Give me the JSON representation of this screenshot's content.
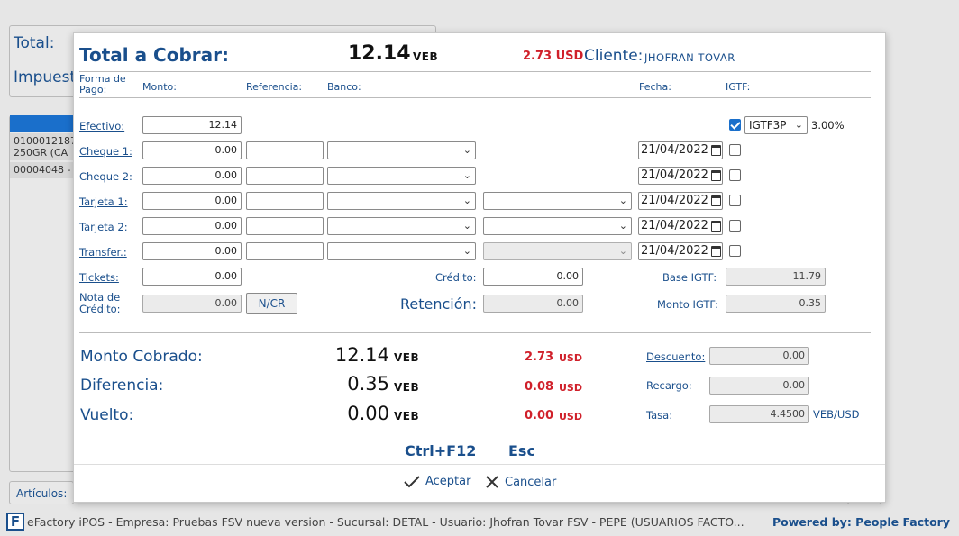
{
  "background": {
    "total_label": "Total:",
    "impuesto_label": "Impuest",
    "list_items": [
      "0100012187",
      "250GR (CA",
      "00004048 -"
    ],
    "articulos_label": "Artículos:"
  },
  "footer": {
    "info": "eFactory iPOS - Empresa: Pruebas FSV nueva version - Sucursal: DETAL - Usuario: Jhofran Tovar FSV - PEPE (USUARIOS FACTO...",
    "powered": "Powered by: People Factory",
    "logo_letter": "F"
  },
  "header": {
    "title": "Total a Cobrar:",
    "total_value": "12.14",
    "total_currency": "VEB",
    "usd_value": "2.73 USD",
    "cliente_label": "Cliente:",
    "cliente_value": "JHOFRAN TOVAR"
  },
  "columns": {
    "forma_de_pago": "Forma de Pago:",
    "monto": "Monto:",
    "referencia": "Referencia:",
    "banco": "Banco:",
    "fecha": "Fecha:",
    "igtf": "IGTF:"
  },
  "payment_rows": [
    {
      "label": "Efectivo:",
      "monto": "12.14"
    },
    {
      "label": "Cheque 1:",
      "monto": "0.00",
      "fecha": "21/04/2022"
    },
    {
      "label": "Cheque 2:",
      "monto": "0.00",
      "fecha": "21/04/2022"
    },
    {
      "label": "Tarjeta 1:",
      "monto": "0.00",
      "fecha": "21/04/2022"
    },
    {
      "label": "Tarjeta 2:",
      "monto": "0.00",
      "fecha": "21/04/2022"
    },
    {
      "label": "Transfer.:",
      "monto": "0.00",
      "fecha": "21/04/2022"
    },
    {
      "label": "Tickets:",
      "monto": "0.00"
    }
  ],
  "igtf": {
    "checked": true,
    "select_value": "IGTF3P",
    "percent": "3.00%"
  },
  "nota_credito": {
    "label": "Nota de Crédito:",
    "value": "0.00",
    "button": "N/CR"
  },
  "credito": {
    "label": "Crédito:",
    "value": "0.00"
  },
  "retencion": {
    "label": "Retención:",
    "value": "0.00"
  },
  "base_igtf": {
    "label": "Base IGTF:",
    "value": "11.79"
  },
  "monto_igtf": {
    "label": "Monto IGTF:",
    "value": "0.35"
  },
  "summary": {
    "monto_cobrado": {
      "label": "Monto Cobrado:",
      "value": "12.14",
      "currency": "VEB",
      "usd": "2.73",
      "usd_currency": "USD"
    },
    "diferencia": {
      "label": "Diferencia:",
      "value": "0.35",
      "currency": "VEB",
      "usd": "0.08",
      "usd_currency": "USD"
    },
    "vuelto": {
      "label": "Vuelto:",
      "value": "0.00",
      "currency": "VEB",
      "usd": "0.00",
      "usd_currency": "USD"
    }
  },
  "right_panel": {
    "descuento": {
      "label": "Descuento:",
      "value": "0.00"
    },
    "recargo": {
      "label": "Recargo:",
      "value": "0.00"
    },
    "tasa": {
      "label": "Tasa:",
      "value": "4.4500",
      "unit": "VEB/USD"
    }
  },
  "shortcuts": {
    "accept_key": "Ctrl+F12",
    "cancel_key": "Esc"
  },
  "actions": {
    "accept": "Aceptar",
    "cancel": "Cancelar"
  },
  "colors": {
    "accent": "#1a4f8c",
    "usd_red": "#d0202a",
    "selected_blue": "#1a6fcb"
  }
}
